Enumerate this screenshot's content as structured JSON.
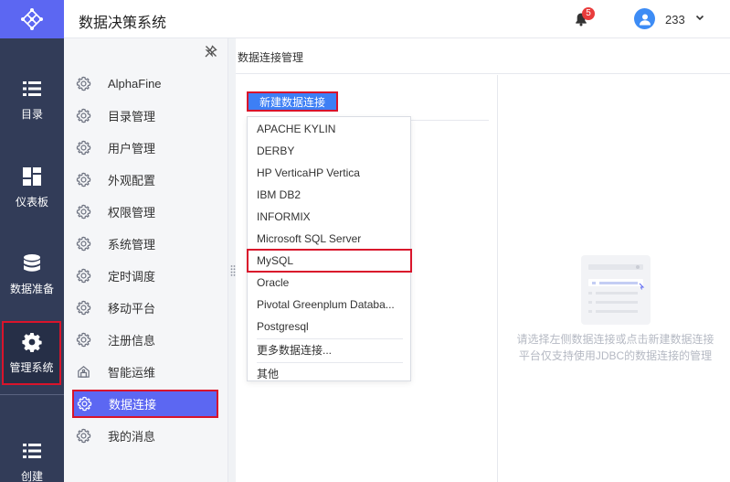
{
  "app": {
    "title": "数据决策系统"
  },
  "header": {
    "notification_count": "5",
    "username": "233"
  },
  "rail": {
    "items": [
      {
        "label": "目录",
        "icon": "list-icon"
      },
      {
        "label": "仪表板",
        "icon": "dashboard-icon"
      },
      {
        "label": "数据准备",
        "icon": "database-icon"
      },
      {
        "label": "管理系统",
        "icon": "gear-icon"
      },
      {
        "label": "创建",
        "icon": "list-icon"
      }
    ]
  },
  "submenu": {
    "items": [
      "AlphaFine",
      "目录管理",
      "用户管理",
      "外观配置",
      "权限管理",
      "系统管理",
      "定时调度",
      "移动平台",
      "注册信息",
      "智能运维",
      "数据连接",
      "我的消息"
    ],
    "active": "数据连接"
  },
  "content": {
    "title": "数据连接管理",
    "new_connection_label": "新建数据连接",
    "dropdown": {
      "items": [
        "APACHE KYLIN",
        "DERBY",
        "HP VerticaHP Vertica",
        "IBM DB2",
        "INFORMIX",
        "Microsoft SQL Server",
        "MySQL",
        "Oracle",
        "Pivotal Greenplum Databa...",
        "Postgresql",
        "更多数据连接...",
        "其他"
      ],
      "highlighted": "MySQL"
    },
    "empty_text_line1": "请选择左侧数据连接或点击新建数据连接",
    "empty_text_line2": "平台仅支持使用JDBC的数据连接的管理"
  },
  "colors": {
    "rail_bg": "#323c58",
    "accent": "#5c67f2",
    "button_blue": "#3d7ff5",
    "highlight_red": "#d9142b",
    "badge_red": "#e93c3c"
  }
}
